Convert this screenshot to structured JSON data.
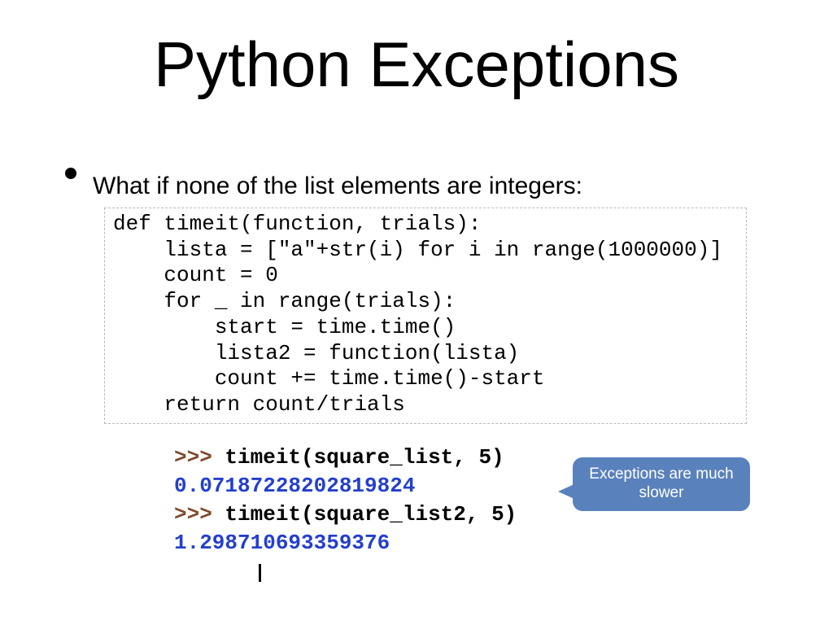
{
  "title": "Python Exceptions",
  "bullet": "What if none of the list elements are integers:",
  "code": {
    "l1": "def timeit(function, trials):",
    "l2": "    lista = [\"a\"+str(i) for i in range(1000000)]",
    "l3": "    count = 0",
    "l4": "    for _ in range(trials):",
    "l5": "        start = time.time()",
    "l6": "        lista2 = function(lista)",
    "l7": "        count += time.time()-start",
    "l8": "    return count/trials"
  },
  "console": {
    "prompt1": ">>> ",
    "call1": "timeit(square_list, 5)",
    "result1": "0.07187228202819824",
    "prompt2": ">>> ",
    "call2": "timeit(square_list2, 5)",
    "result2": "1.298710693359376"
  },
  "callout": "Exceptions are much slower"
}
